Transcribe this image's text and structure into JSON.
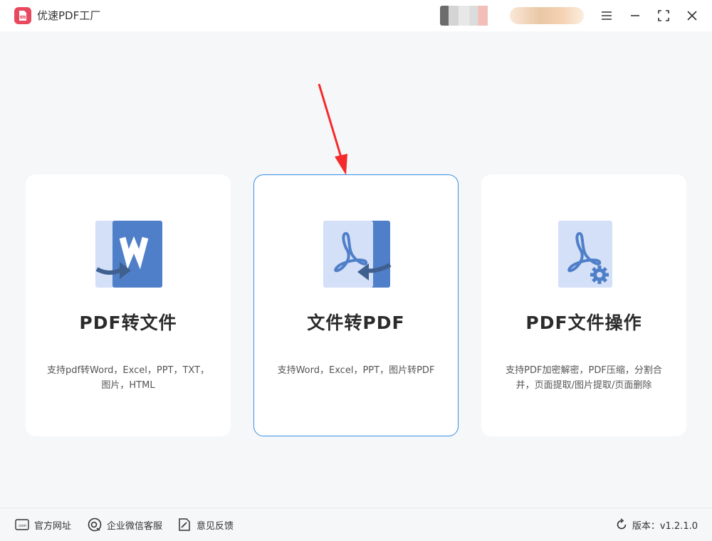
{
  "app": {
    "title": "优速PDF工厂",
    "logo_icon": "pdf-logo-icon",
    "accent": "#3a8ee6",
    "brand": "#e8495f"
  },
  "window_controls": {
    "menu_icon": "hamburger-menu-icon",
    "minimize_icon": "minimize-icon",
    "maximize_icon": "maximize-icon",
    "close_icon": "close-icon"
  },
  "cards": [
    {
      "title": "PDF转文件",
      "desc_line1": "支持pdf转Word，Excel，PPT，TXT，",
      "desc_line2": "图片，HTML",
      "icon": "pdf-to-word-icon"
    },
    {
      "title": "文件转PDF",
      "desc_line1": "支持Word，Excel，PPT，图片转PDF",
      "desc_line2": "",
      "icon": "file-to-pdf-icon"
    },
    {
      "title": "PDF文件操作",
      "desc_line1": "支持PDF加密解密，PDF压缩，分割合",
      "desc_line2": "并，页面提取/图片提取/页面删除",
      "icon": "pdf-settings-icon"
    }
  ],
  "footer": {
    "website": "官方网址",
    "wechat": "企业微信客服",
    "feedback": "意见反馈",
    "version": "版本：v1.2.1.0"
  }
}
